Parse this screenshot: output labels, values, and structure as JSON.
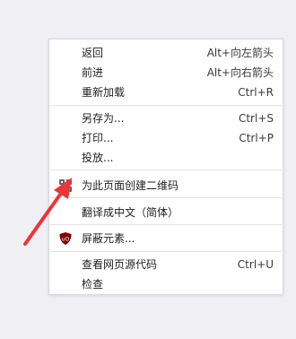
{
  "menu": {
    "items": [
      {
        "label": "返回",
        "shortcut": "Alt+向左箭头"
      },
      {
        "label": "前进",
        "shortcut": "Alt+向右箭头"
      },
      {
        "label": "重新加载",
        "shortcut": "Ctrl+R"
      },
      {
        "label": "另存为...",
        "shortcut": "Ctrl+S"
      },
      {
        "label": "打印...",
        "shortcut": "Ctrl+P"
      },
      {
        "label": "投放...",
        "shortcut": ""
      },
      {
        "label": "为此页面创建二维码",
        "shortcut": "",
        "icon": "qr-code-icon"
      },
      {
        "label": "翻译成中文（简体）",
        "shortcut": ""
      },
      {
        "label": "屏蔽元素...",
        "shortcut": "",
        "icon": "ublock-origin-icon"
      },
      {
        "label": "查看网页源代码",
        "shortcut": "Ctrl+U"
      },
      {
        "label": "检查",
        "shortcut": ""
      }
    ]
  },
  "annotation": {
    "icon": "red-arrow-annotation",
    "color": "#e8363a"
  },
  "colors": {
    "menu_background": "#ffffff",
    "page_background": "#f0f0f4",
    "separator": "#e3e3e8",
    "ublock_red": "#800000"
  }
}
